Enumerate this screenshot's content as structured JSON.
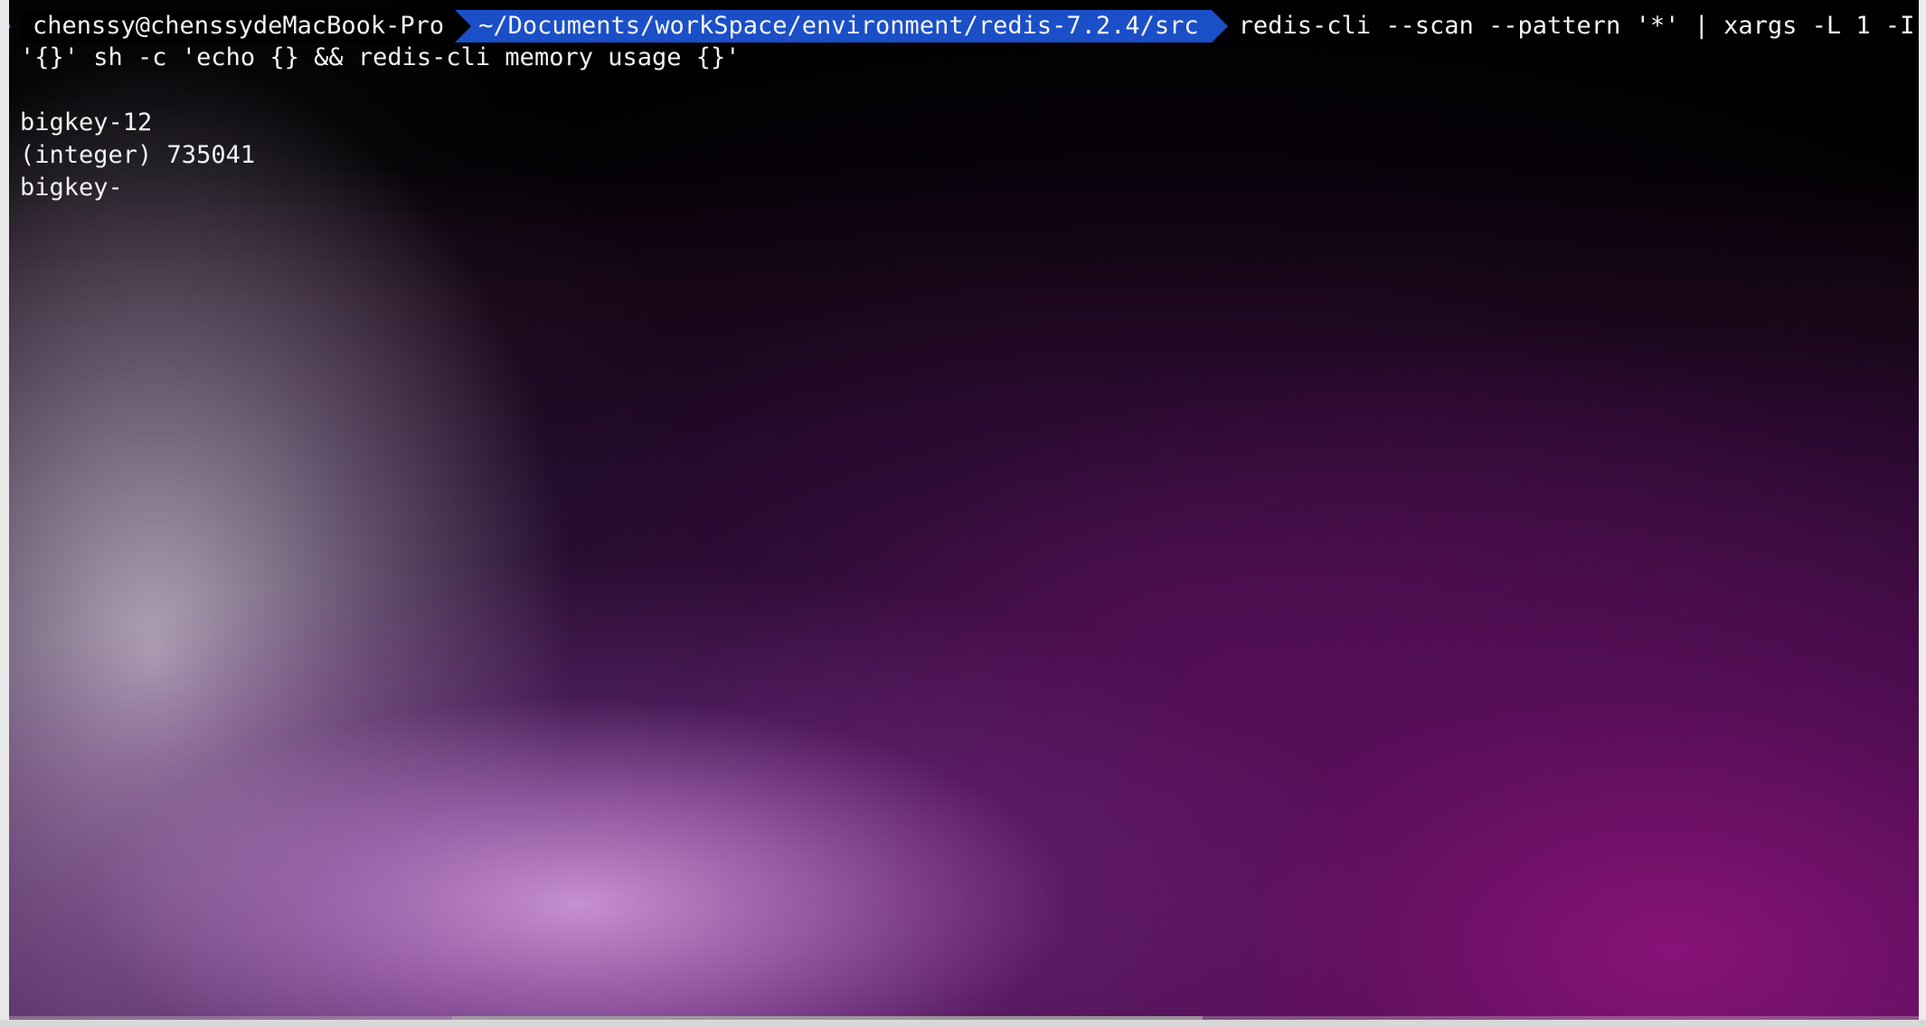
{
  "window": {
    "type": "terminal"
  },
  "prompt": {
    "user_host": "chenssy@chenssydeMacBook-Pro",
    "path": "~/Documents/workSpace/environment/redis-7.2.4/src",
    "command": "redis-cli --scan --pattern '*' | xargs -L 1 -I",
    "command_continued": "'{}' sh -c 'echo {} && redis-cli memory usage {}'"
  },
  "output": {
    "lines": [
      "",
      "bigkey-12",
      "(integer) 735041",
      "bigkey-"
    ]
  },
  "colors": {
    "path_segment": "#1a4fc7",
    "text": "#f2f2f2",
    "background": "#000000"
  },
  "icons": {
    "prompt_caret": "chevron-right-icon",
    "segment_separator": "powerline-arrow-icon"
  }
}
